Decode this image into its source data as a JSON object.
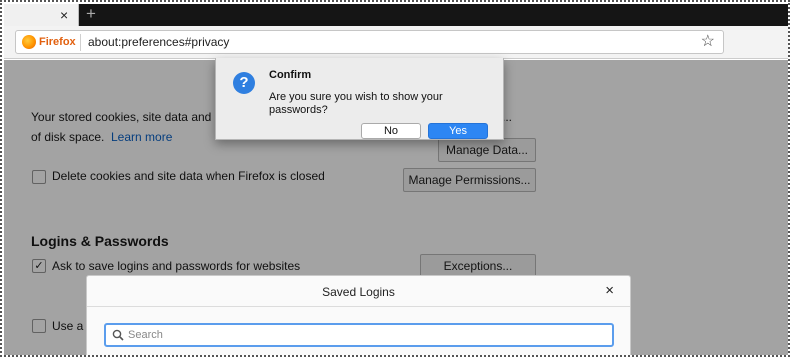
{
  "browser": {
    "url": "about:preferences#privacy",
    "identity_label": "Firefox",
    "tab_close": "×",
    "new_tab": "+",
    "bookmark_star": "☆"
  },
  "prefs": {
    "clipped_text": "Your stored cookies, site data and ca",
    "clipped_text_right": "...",
    "disk_space_text": "of disk space.",
    "learn_more": "Learn more",
    "manage_data": "Manage Data...",
    "delete_cookies_label": "Delete cookies and site data when Firefox is closed",
    "manage_permissions": "Manage Permissions...",
    "logins_heading": "Logins & Passwords",
    "ask_save_label": "Ask to save logins and passwords for websites",
    "ask_save_check": "✓",
    "exceptions": "Exceptions...",
    "use_master_partial": "Use a m"
  },
  "saved_logins": {
    "title": "Saved Logins",
    "close": "×",
    "search_placeholder": "Search"
  },
  "confirm": {
    "icon": "?",
    "title": "Confirm",
    "message": "Are you sure you wish to show your passwords?",
    "no": "No",
    "yes": "Yes"
  },
  "colors": {
    "accent": "#2d86f3",
    "link": "#0a61c6",
    "firefox_orange": "#e2600f"
  }
}
